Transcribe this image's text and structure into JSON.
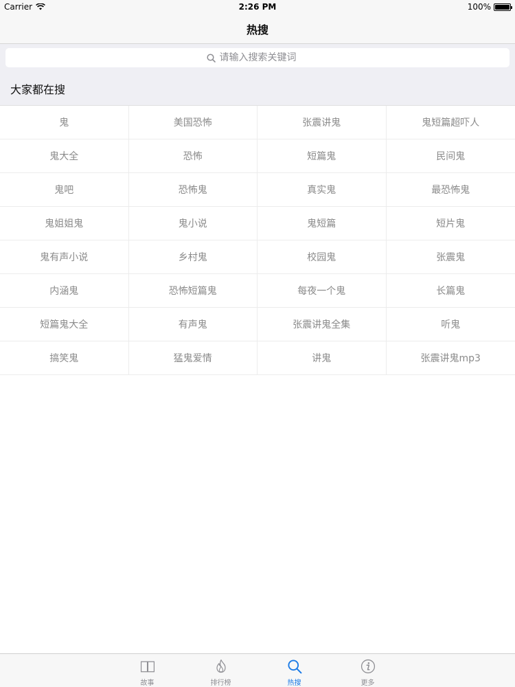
{
  "status_bar": {
    "carrier": "Carrier",
    "time": "2:26 PM",
    "battery": "100%"
  },
  "nav": {
    "title": "热搜"
  },
  "search": {
    "placeholder": "请输入搜索关键词",
    "value": ""
  },
  "section": {
    "title": "大家都在搜"
  },
  "grid": [
    "鬼",
    "美国恐怖",
    "张震讲鬼",
    "鬼短篇超吓人",
    "鬼大全",
    "恐怖",
    "短篇鬼",
    "民间鬼",
    "鬼吧",
    "恐怖鬼",
    "真实鬼",
    "最恐怖鬼",
    "鬼姐姐鬼",
    "鬼小说",
    "鬼短篇",
    "短片鬼",
    "鬼有声小说",
    "乡村鬼",
    "校园鬼",
    "张震鬼",
    "内涵鬼",
    "恐怖短篇鬼",
    "每夜一个鬼",
    "长篇鬼",
    "短篇鬼大全",
    "有声鬼",
    "张震讲鬼全集",
    "听鬼",
    "搞笑鬼",
    "猛鬼爱情",
    "讲鬼",
    "张震讲鬼mp3"
  ],
  "tabs": [
    {
      "label": "故事",
      "icon": "book-icon",
      "active": false
    },
    {
      "label": "排行榜",
      "icon": "flame-icon",
      "active": false
    },
    {
      "label": "热搜",
      "icon": "search-icon",
      "active": true
    },
    {
      "label": "更多",
      "icon": "info-icon",
      "active": false
    }
  ],
  "colors": {
    "accent": "#1a7ae6",
    "inactive": "#8e8e93",
    "cell_text": "#8a8a8a"
  }
}
